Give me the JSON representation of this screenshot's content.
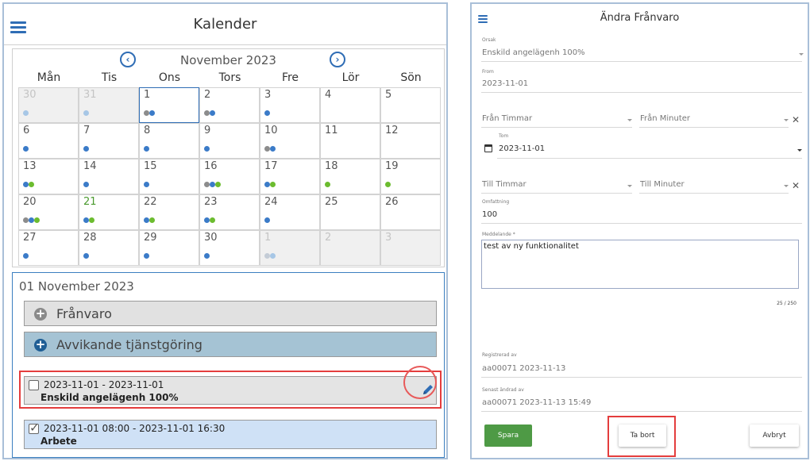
{
  "colors": {
    "accent": "#2f6db5",
    "dot_blue": "#3b7bc8",
    "dot_gray": "#8c8c8c",
    "dot_green": "#6cbc2f",
    "dot_light": "#a7c7e6",
    "dot_lightgray": "#c4ccd6",
    "franvaro_bg": "#e1e1e1",
    "avvikande_bg": "#a5c3d4",
    "arbete_bg": "#cfe1f6",
    "highlight": "#e43d3d",
    "save_green": "#4e9a45"
  },
  "calendar": {
    "title": "Kalender",
    "month_label": "November 2023",
    "prev_icon": "chevron-left-circle-icon",
    "next_icon": "chevron-right-circle-icon",
    "days_of_week": [
      "Mån",
      "Tis",
      "Ons",
      "Tors",
      "Fre",
      "Lör",
      "Sön"
    ],
    "weeks": [
      [
        {
          "day": "30",
          "muted": true,
          "dots": [
            "light"
          ]
        },
        {
          "day": "31",
          "muted": true,
          "dots": [
            "light"
          ]
        },
        {
          "day": "1",
          "selected": true,
          "dots": [
            "gray",
            "blue"
          ]
        },
        {
          "day": "2",
          "dots": [
            "gray",
            "blue"
          ]
        },
        {
          "day": "3",
          "dots": [
            "blue"
          ]
        },
        {
          "day": "4",
          "dots": []
        },
        {
          "day": "5",
          "dots": []
        }
      ],
      [
        {
          "day": "6",
          "dots": [
            "blue"
          ]
        },
        {
          "day": "7",
          "dots": [
            "blue"
          ]
        },
        {
          "day": "8",
          "dots": [
            "blue"
          ]
        },
        {
          "day": "9",
          "dots": [
            "blue"
          ]
        },
        {
          "day": "10",
          "dots": [
            "gray",
            "blue"
          ]
        },
        {
          "day": "11",
          "dots": []
        },
        {
          "day": "12",
          "dots": []
        }
      ],
      [
        {
          "day": "13",
          "dots": [
            "blue",
            "green"
          ]
        },
        {
          "day": "14",
          "dots": [
            "blue"
          ]
        },
        {
          "day": "15",
          "dots": [
            "blue"
          ]
        },
        {
          "day": "16",
          "dots": [
            "gray",
            "blue",
            "green"
          ]
        },
        {
          "day": "17",
          "dots": [
            "blue",
            "green"
          ]
        },
        {
          "day": "18",
          "dots": [
            "green"
          ]
        },
        {
          "day": "19",
          "dots": [
            "green"
          ]
        }
      ],
      [
        {
          "day": "20",
          "dots": [
            "gray",
            "blue",
            "green"
          ]
        },
        {
          "day": "21",
          "green_text": true,
          "dots": [
            "blue",
            "green"
          ]
        },
        {
          "day": "22",
          "dots": [
            "blue",
            "green"
          ]
        },
        {
          "day": "23",
          "dots": [
            "blue",
            "green"
          ]
        },
        {
          "day": "24",
          "dots": [
            "blue"
          ]
        },
        {
          "day": "25",
          "dots": []
        },
        {
          "day": "26",
          "dots": []
        }
      ],
      [
        {
          "day": "27",
          "dots": [
            "blue"
          ]
        },
        {
          "day": "28",
          "dots": [
            "blue"
          ]
        },
        {
          "day": "29",
          "dots": [
            "blue"
          ]
        },
        {
          "day": "30",
          "dots": [
            "blue"
          ]
        },
        {
          "day": "1",
          "muted": true,
          "dots": [
            "lightgray",
            "light"
          ]
        },
        {
          "day": "2",
          "muted": true,
          "dots": []
        },
        {
          "day": "3",
          "muted": true,
          "dots": []
        }
      ]
    ]
  },
  "day_panel": {
    "date_title": "01 November 2023",
    "add_franvaro": "Frånvaro",
    "add_avvikande": "Avvikande tjänstgöring",
    "plus_icon": "plus-circle-icon",
    "entries": [
      {
        "time": "2023-11-01 - 2023-11-01",
        "type": "Enskild angelägenh 100%",
        "checked": false,
        "edit_icon": "pencil-icon"
      },
      {
        "time": "2023-11-01 08:00 - 2023-11-01 16:30",
        "type": "Arbete",
        "checked": true
      }
    ]
  },
  "form": {
    "title": "Ändra Frånvaro",
    "orsak_label": "Orsak",
    "orsak_value": "Enskild angelägenh 100%",
    "from_label": "From",
    "from_value": "2023-11-01",
    "fran_timmar": "Från Timmar",
    "fran_minuter": "Från Minuter",
    "tom_label": "Tom",
    "tom_value": "2023-11-01",
    "till_timmar": "Till Timmar",
    "till_minuter": "Till Minuter",
    "omfattning_label": "Omfattning",
    "omfattning_value": "100",
    "meddelande_label": "Meddelande *",
    "meddelande_value": "test av ny funktionalitet",
    "char_counter": "25 / 250",
    "registrerad_label": "Registrerad av",
    "registrerad_value": "aa00071 2023-11-13",
    "andrad_label": "Senast ändrad av",
    "andrad_value": "aa00071 2023-11-13 15:49",
    "clear_icon": "close-icon",
    "calendar_icon": "calendar-icon",
    "save_label": "Spara",
    "delete_label": "Ta bort",
    "cancel_label": "Avbryt"
  }
}
